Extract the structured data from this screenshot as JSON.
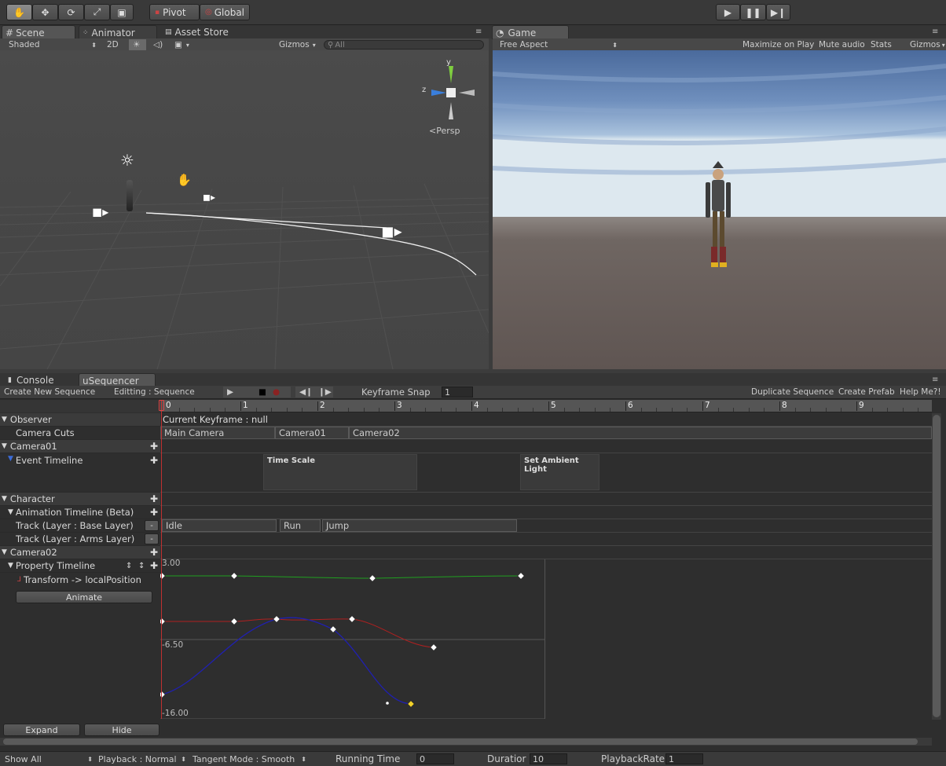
{
  "toolbar": {
    "pivot_label": "Pivot",
    "global_label": "Global"
  },
  "scene_panel": {
    "tabs": [
      {
        "label": "Scene",
        "icon": "hash-icon"
      },
      {
        "label": "Animator",
        "icon": "animator-icon"
      },
      {
        "label": "Asset Store",
        "icon": "store-icon"
      }
    ],
    "shading_mode": "Shaded",
    "mode_2d_label": "2D",
    "gizmos_label": "Gizmos",
    "search_placeholder": "All",
    "gizmo": {
      "y_label": "y",
      "z_label": "z"
    },
    "projection_label": "Persp"
  },
  "game_panel": {
    "tab_label": "Game",
    "aspect_label": "Free Aspect",
    "maximize_label": "Maximize on Play",
    "mute_label": "Mute audio",
    "stats_label": "Stats",
    "gizmos_label": "Gizmos"
  },
  "lower_panel": {
    "tabs": [
      {
        "label": "Console",
        "icon": "console-icon"
      },
      {
        "label": "uSequencer"
      }
    ]
  },
  "sequencer": {
    "create_label": "Create New Sequence",
    "editing_label": "Editting : Sequence",
    "keyframe_snap_label": "Keyframe Snap",
    "keyframe_snap_value": "1",
    "duplicate_label": "Duplicate Sequence",
    "create_prefab_label": "Create Prefab",
    "help_label": "Help Me?!",
    "ruler_ticks": [
      "0",
      "1",
      "2",
      "3",
      "4",
      "5",
      "6",
      "7",
      "8",
      "9"
    ],
    "rows": {
      "observer": "Observer",
      "camera_cuts": "Camera Cuts",
      "camera01": "Camera01",
      "event_timeline": "Event Timeline",
      "character": "Character",
      "animation_timeline": "Animation Timeline (Beta)",
      "track_base": "Track (Layer : Base Layer)",
      "track_arms": "Track (Layer : Arms Layer)",
      "camera02": "Camera02",
      "property_timeline": "Property Timeline",
      "transform_property": "Transform -> localPosition"
    },
    "current_keyframe": "Current Keyframe : null",
    "camera_cut_clips": [
      "Main Camera",
      "Camera01",
      "Camera02"
    ],
    "event_clips": [
      "Time Scale",
      "Set Ambient Light"
    ],
    "animation_clips": [
      "Idle",
      "Run",
      "Jump"
    ],
    "animate_label": "Animate",
    "curve_labels": {
      "top": "3.00",
      "mid": "-6.50",
      "bottom": "-16.00"
    },
    "expand_label": "Expand",
    "hide_label": "Hide",
    "curve_colors": {
      "x": "#b02020",
      "y": "#20a020",
      "z": "#2020b0"
    }
  },
  "status": {
    "show_all": "Show All",
    "playback": "Playback : Normal",
    "tangent_mode": "Tangent Mode : Smooth",
    "running_time_label": "Running Time",
    "running_time_value": "0",
    "duration_label": "Duratior",
    "duration_value": "10",
    "playback_rate_label": "PlaybackRate",
    "playback_rate_value": "1"
  }
}
